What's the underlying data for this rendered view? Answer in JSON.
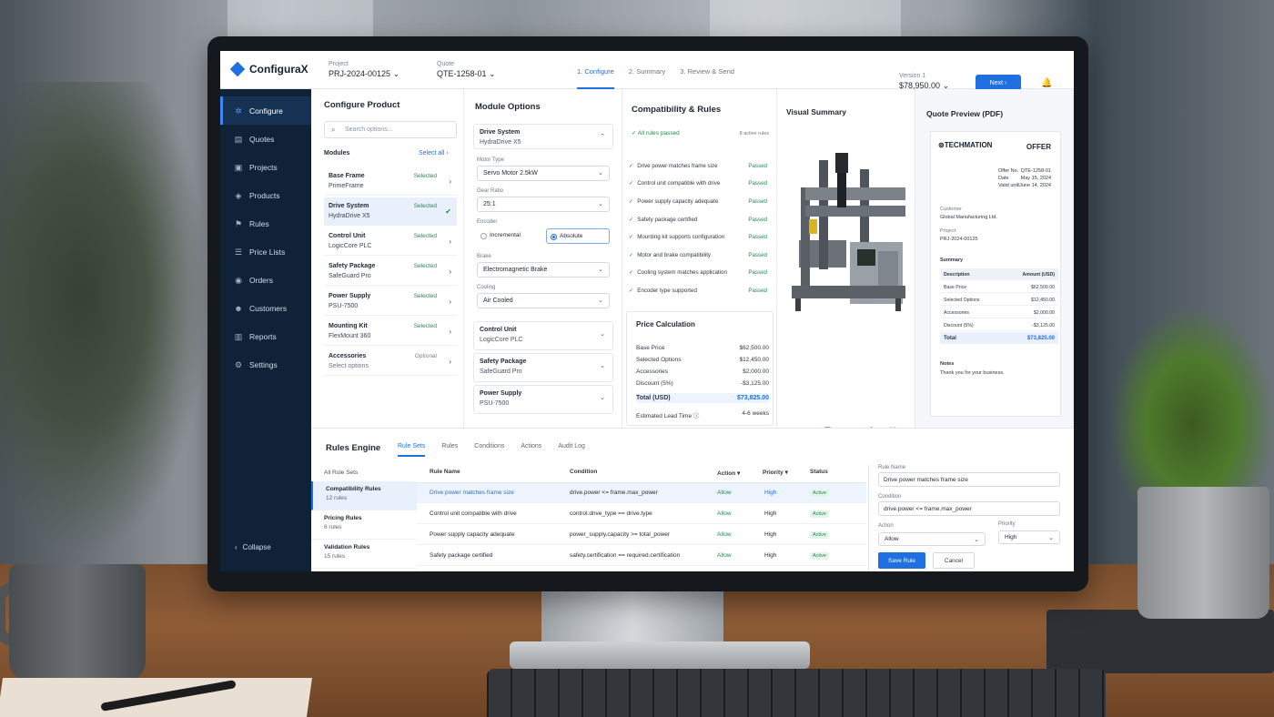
{
  "app": {
    "name": "ConfiguraX"
  },
  "header": {
    "project_label": "Project",
    "project_value": "PRJ-2024-00125",
    "quote_label": "Quote",
    "quote_value": "QTE-1258-01",
    "steps": [
      "1. Configure",
      "2. Summary",
      "3. Review & Send"
    ],
    "version_label": "Version 1",
    "version_value": "$78,950.00",
    "next_label": "Next"
  },
  "sidebar": {
    "items": [
      {
        "label": "Configure",
        "icon": "gear-cluster-icon"
      },
      {
        "label": "Quotes",
        "icon": "document-icon"
      },
      {
        "label": "Projects",
        "icon": "folder-icon"
      },
      {
        "label": "Products",
        "icon": "cube-icon"
      },
      {
        "label": "Rules",
        "icon": "rules-icon"
      },
      {
        "label": "Price Lists",
        "icon": "list-icon"
      },
      {
        "label": "Orders",
        "icon": "orders-icon"
      },
      {
        "label": "Customers",
        "icon": "users-icon"
      },
      {
        "label": "Reports",
        "icon": "chart-icon"
      },
      {
        "label": "Settings",
        "icon": "settings-icon"
      }
    ],
    "collapse_label": "Collapse"
  },
  "configure": {
    "title": "Configure Product",
    "search_placeholder": "Search options...",
    "modules_label": "Modules",
    "select_all": "Select all",
    "modules": [
      {
        "name": "Base Frame",
        "sub": "PrimeFrame",
        "status": "Selected"
      },
      {
        "name": "Drive System",
        "sub": "HydraDrive X5",
        "status": "Selected"
      },
      {
        "name": "Control Unit",
        "sub": "LogicCore PLC",
        "status": "Selected"
      },
      {
        "name": "Safety Package",
        "sub": "SafeGuard Pro",
        "status": "Selected"
      },
      {
        "name": "Power Supply",
        "sub": "PSU-7500",
        "status": "Selected"
      },
      {
        "name": "Mounting Kit",
        "sub": "FlexMount 360",
        "status": "Selected"
      },
      {
        "name": "Accessories",
        "sub": "Select options",
        "status": "Optional"
      }
    ]
  },
  "module_options": {
    "title": "Module Options",
    "drive_title": "Drive System",
    "drive_sub": "HydraDrive X5",
    "motor_label": "Motor Type",
    "motor_value": "Servo Motor 2.5kW",
    "gear_label": "Gear Ratio",
    "gear_value": "25:1",
    "encoder_label": "Encoder",
    "encoder_a": "Incremental",
    "encoder_b": "Absolute",
    "brake_label": "Brake",
    "brake_value": "Electromagnetic Brake",
    "cooling_label": "Cooling",
    "cooling_value": "Air Cooled",
    "collapsed": [
      {
        "name": "Control Unit",
        "sub": "LogicCore PLC"
      },
      {
        "name": "Safety Package",
        "sub": "SafeGuard Pro"
      },
      {
        "name": "Power Supply",
        "sub": "PSU-7500"
      }
    ]
  },
  "compat": {
    "title": "Compatibility & Rules",
    "all_passed": "All rules passed",
    "active_count": "8 active rules",
    "rules": [
      "Drive power matches frame size",
      "Control unit compatible with drive",
      "Power supply capacity adequate",
      "Safety package certified",
      "Mounting kit supports configuration",
      "Motor and brake compatibility",
      "Cooling system matches application",
      "Encoder type supported"
    ],
    "passed": "Passed"
  },
  "price": {
    "title": "Price Calculation",
    "rows": [
      {
        "label": "Base Price",
        "value": "$62,500.00"
      },
      {
        "label": "Selected Options",
        "value": "$12,450.00"
      },
      {
        "label": "Accessories",
        "value": "$2,000.00"
      },
      {
        "label": "Discount (5%)",
        "value": "-$3,125.00"
      }
    ],
    "total_label": "Total (USD)",
    "total_value": "$73,825.00",
    "lead_label": "Estimated Lead Time",
    "lead_value": "4-6 weeks"
  },
  "visual": {
    "title": "Visual Summary"
  },
  "quote_preview": {
    "title": "Quote Preview (PDF)",
    "brand": "TECHMATION",
    "doc_type": "OFFER",
    "meta": [
      {
        "k": "Offer No.",
        "v": "QTE-1258-01"
      },
      {
        "k": "Date",
        "v": "May 15, 2024"
      },
      {
        "k": "Valid until",
        "v": "June 14, 2024"
      }
    ],
    "customer_label": "Customer",
    "customer_value": "Global Manufacturing Ltd.",
    "project_label": "Project",
    "project_value": "PRJ-2024-00125",
    "summary_label": "Summary",
    "col_desc": "Description",
    "col_amount": "Amount (USD)",
    "rows": [
      {
        "label": "Base Price",
        "value": "$62,500.00"
      },
      {
        "label": "Selected Options",
        "value": "$12,450.00"
      },
      {
        "label": "Accessories",
        "value": "$2,000.00"
      },
      {
        "label": "Discount (5%)",
        "value": "-$3,125.00"
      }
    ],
    "total_label": "Total",
    "total_value": "$73,825.00",
    "notes_label": "Notes",
    "notes_value": "Thank you for your business."
  },
  "rules_engine": {
    "title": "Rules Engine",
    "tabs": [
      "Rule Sets",
      "Rules",
      "Conditions",
      "Actions",
      "Audit Log"
    ],
    "sets_header": "All Rule Sets",
    "sets": [
      {
        "name": "Compatibility Rules",
        "count": "12 rules"
      },
      {
        "name": "Pricing Rules",
        "count": "8 rules"
      },
      {
        "name": "Validation Rules",
        "count": "15 rules"
      }
    ],
    "columns": [
      "Rule Name",
      "Condition",
      "Action",
      "Priority",
      "Status"
    ],
    "rows": [
      {
        "name": "Drive power matches frame size",
        "condition": "drive.power <= frame.max_power",
        "action": "Allow",
        "priority": "High",
        "status": "Active"
      },
      {
        "name": "Control unit compatible with drive",
        "condition": "control.drive_type == drive.type",
        "action": "Allow",
        "priority": "High",
        "status": "Active"
      },
      {
        "name": "Power supply capacity adequate",
        "condition": "power_supply.capacity >= total_power",
        "action": "Allow",
        "priority": "High",
        "status": "Active"
      },
      {
        "name": "Safety package certified",
        "condition": "safety.certification == required.certification",
        "action": "Allow",
        "priority": "High",
        "status": "Active"
      }
    ],
    "form": {
      "name_label": "Rule Name",
      "name_value": "Drive power matches frame size",
      "cond_label": "Condition",
      "cond_value": "drive.power <= frame.max_power",
      "action_label": "Action",
      "action_value": "Allow",
      "priority_label": "Priority",
      "priority_value": "High",
      "save_label": "Save Rule",
      "cancel_label": "Cancel"
    }
  },
  "colors": {
    "accent": "#1f6fe0",
    "sidebar": "#0f2238",
    "success": "#1f8a4c"
  }
}
